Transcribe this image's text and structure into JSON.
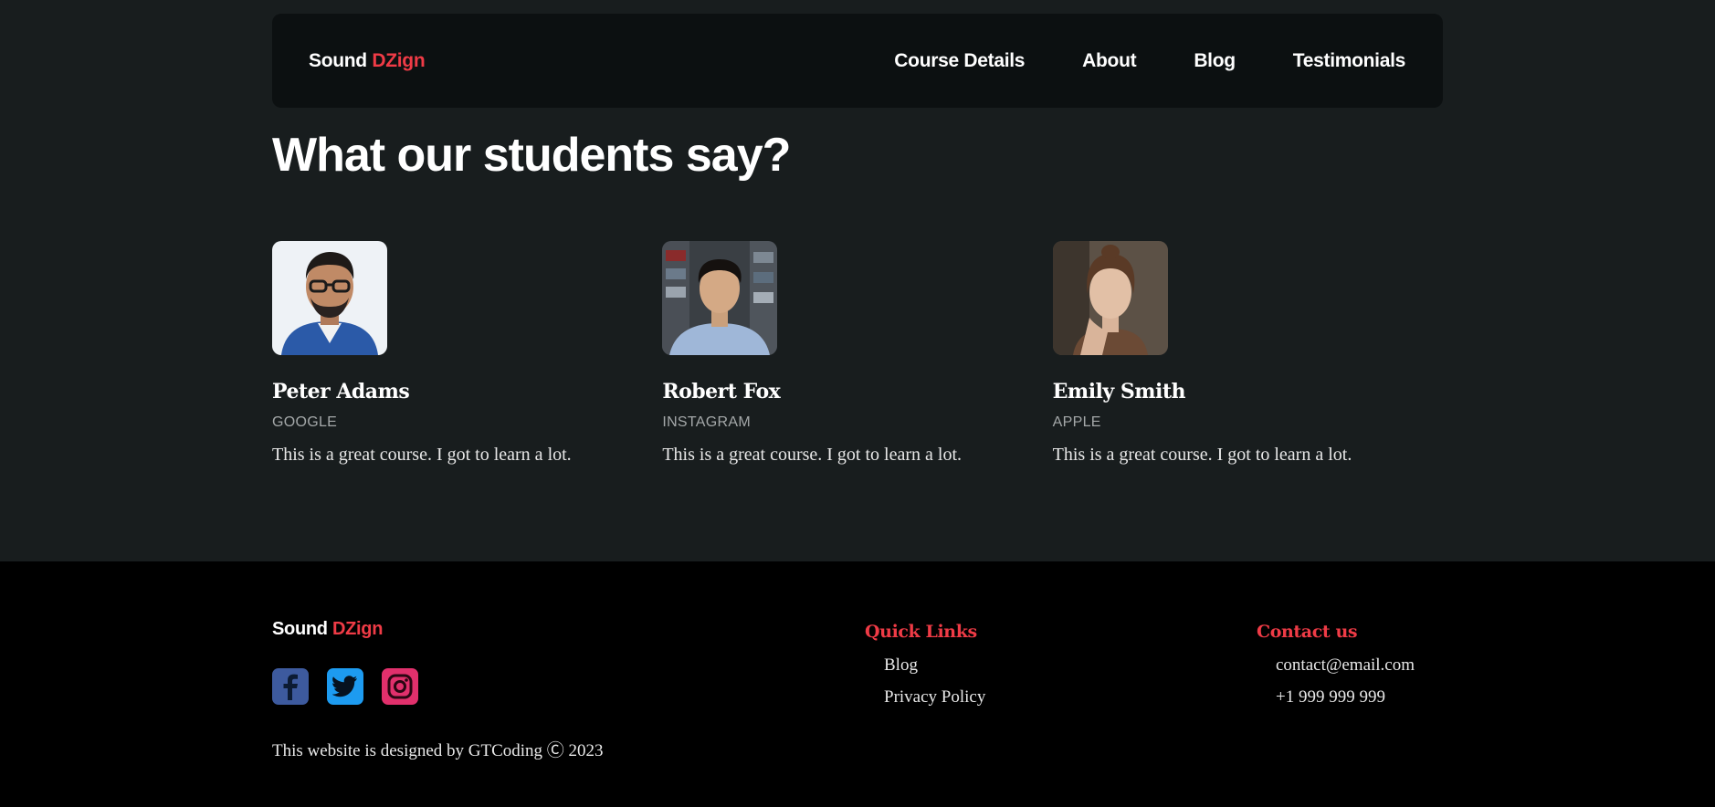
{
  "navbar": {
    "brand_primary": "Sound",
    "brand_accent": "DZign",
    "links": [
      "Course Details",
      "About",
      "Blog",
      "Testimonials"
    ]
  },
  "section": {
    "title": "What our students say?"
  },
  "testimonials": [
    {
      "name": "Peter Adams",
      "company": "GOOGLE",
      "quote": "This is a great course. I got to learn a lot."
    },
    {
      "name": "Robert Fox",
      "company": "INSTAGRAM",
      "quote": "This is a great course. I got to learn a lot."
    },
    {
      "name": "Emily Smith",
      "company": "APPLE",
      "quote": "This is a great course. I got to learn a lot."
    }
  ],
  "footer": {
    "brand_primary": "Sound",
    "brand_accent": "DZign",
    "socials": [
      "facebook-icon",
      "twitter-icon",
      "instagram-icon"
    ],
    "copyright": "This website is designed by GTCoding Ⓒ 2023",
    "quick_links": {
      "title": "Quick Links",
      "items": [
        "Blog",
        "Privacy Policy"
      ]
    },
    "contact": {
      "title": "Contact us",
      "items": [
        "contact@email.com",
        "+1 999 999 999"
      ]
    }
  },
  "colors": {
    "accent": "#ef3b46",
    "background": "#181d1e",
    "navbar": "#0c1011",
    "footer": "#000000"
  }
}
